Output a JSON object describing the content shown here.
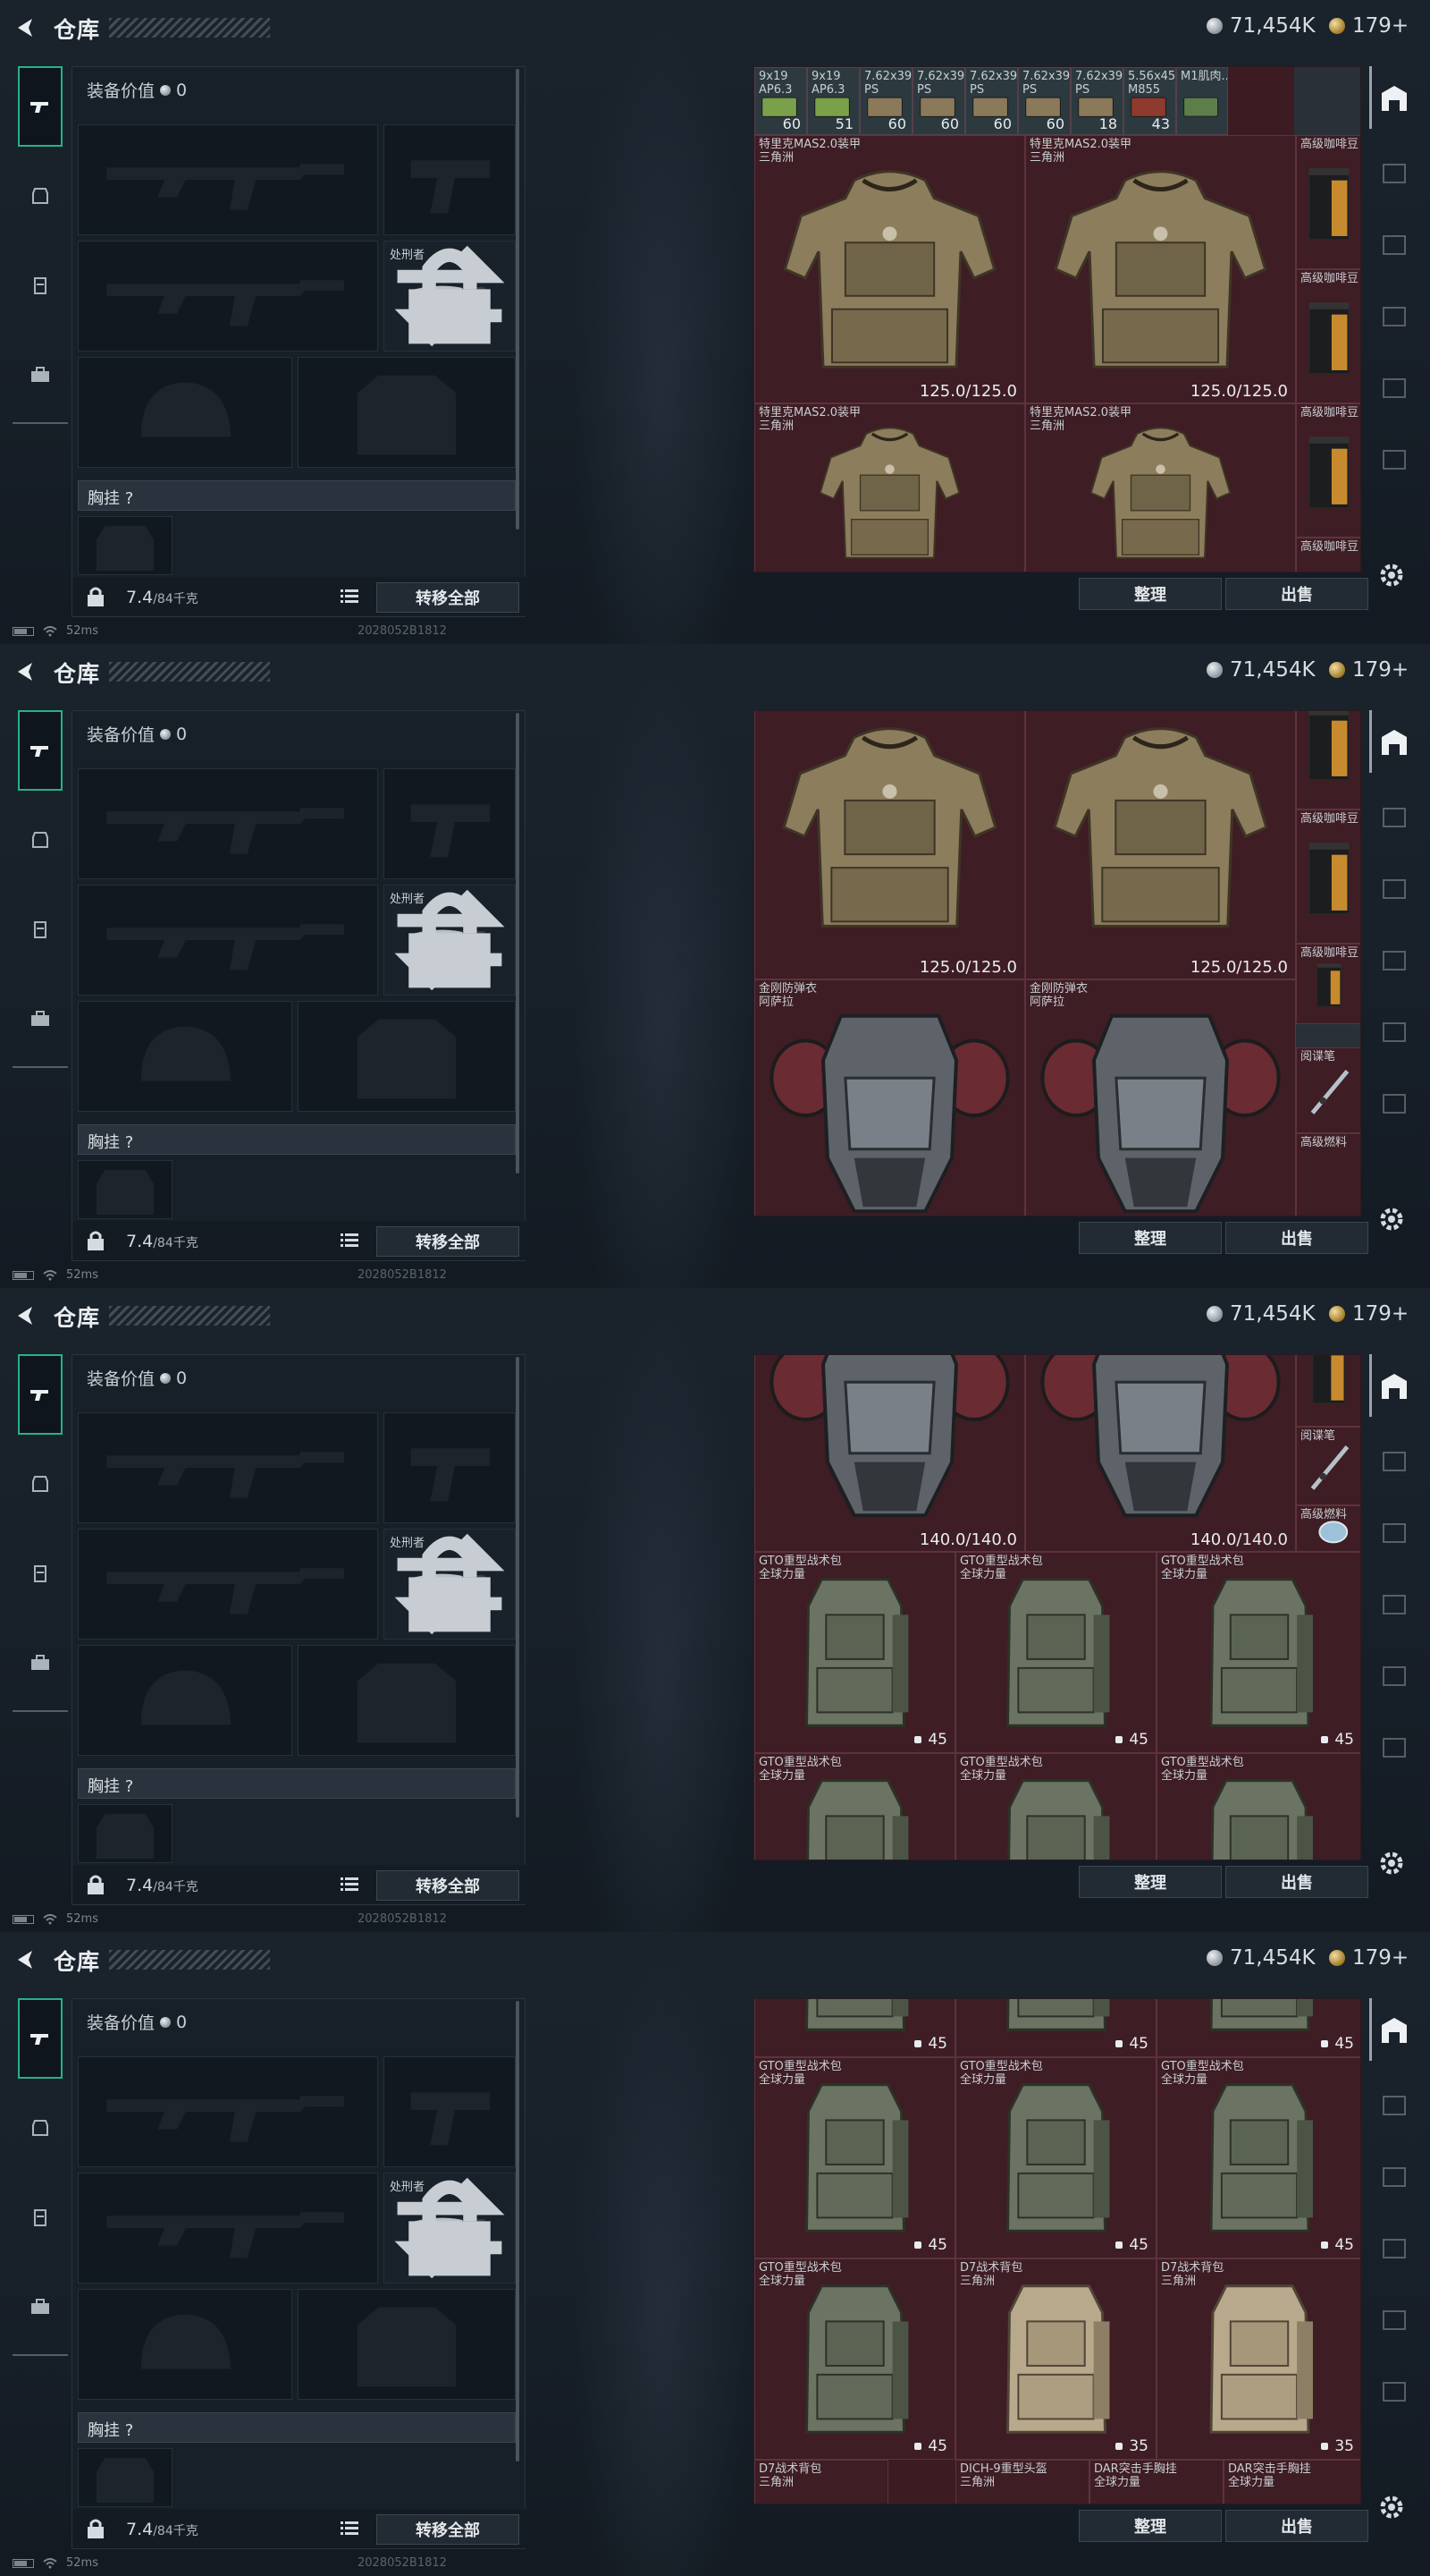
{
  "title": "仓库",
  "currency": {
    "silver": "71,454K",
    "gold": "179+"
  },
  "equipment": {
    "value_label": "装备价值",
    "value": "0",
    "knife_label": "处刑者",
    "chest_label": "胸挂 ?",
    "weight": "7.4",
    "weight_max": "/84千克",
    "transfer_all": "转移全部"
  },
  "storage_buttons": {
    "sort": "整理",
    "sell": "出售"
  },
  "status": {
    "ping": "52ms",
    "build": "2028052B1812"
  },
  "frames": [
    {
      "cells": [
        {
          "name": "9x19\nAP6.3",
          "count": "60",
          "ammo": true
        },
        {
          "name": "9x19\nAP6.3",
          "count": "51",
          "ammo": true
        },
        {
          "name": "7.62x39\nPS",
          "count": "60",
          "ammo": true
        },
        {
          "name": "7.62x39\nPS",
          "count": "60",
          "ammo": true
        },
        {
          "name": "7.62x39\nPS",
          "count": "60",
          "ammo": true
        },
        {
          "name": "7.62x39\nPS",
          "count": "60",
          "ammo": true
        },
        {
          "name": "7.62x39\nPS",
          "count": "18",
          "ammo": true
        },
        {
          "name": "5.56x45\nM855",
          "count": "43",
          "ammo": true
        },
        {
          "name": "M1肌肉...",
          "count": "",
          "ammo": true
        },
        {
          "name": "特里克MAS2.0装甲\n三角洲",
          "dur": "125.0/125.0",
          "art": "vest"
        },
        {
          "name": "特里克MAS2.0装甲\n三角洲",
          "dur": "125.0/125.0",
          "art": "vest"
        },
        {
          "name": "高级咖啡豆",
          "art": "coffee"
        },
        {
          "name": "高级咖啡豆",
          "art": "coffee"
        },
        {
          "name": "特里克MAS2.0装甲\n三角洲",
          "dur": "",
          "art": "vest"
        },
        {
          "name": "特里克MAS2.0装甲\n三角洲",
          "dur": "",
          "art": "vest"
        },
        {
          "name": "高级咖啡豆",
          "art": "coffee"
        },
        {
          "name": "高级咖啡豆",
          "art": "none"
        }
      ]
    },
    {
      "cells": [
        {
          "name": "特里克MAS2.0装甲\n三角洲",
          "dur": "125.0/125.0",
          "art": "vest"
        },
        {
          "name": "特里克MAS2.0装甲\n三角洲",
          "dur": "125.0/125.0",
          "art": "vest"
        },
        {
          "name": "高级咖啡豆",
          "art": "coffee"
        },
        {
          "name": "高级咖啡豆",
          "art": "coffee"
        },
        {
          "name": "金刚防弹衣\n阿萨拉",
          "dur": "",
          "art": "heavy"
        },
        {
          "name": "金刚防弹衣\n阿萨拉",
          "dur": "",
          "art": "heavy"
        },
        {
          "name": "高级咖啡豆",
          "art": "coffee"
        },
        {
          "name": "阅谍笔",
          "art": "pen"
        },
        {
          "name": "高级燃料",
          "art": "none"
        }
      ]
    },
    {
      "cells": [
        {
          "name": "",
          "dur": "140.0/140.0",
          "art": "heavy"
        },
        {
          "name": "",
          "dur": "140.0/140.0",
          "art": "heavy"
        },
        {
          "name": "",
          "art": "coffee"
        },
        {
          "name": "阅谍笔",
          "art": "pen"
        },
        {
          "name": "高级燃料",
          "art": "fuel"
        },
        {
          "name": "GTO重型战术包\n全球力量",
          "cap": "45",
          "art": "pack"
        },
        {
          "name": "GTO重型战术包\n全球力量",
          "cap": "45",
          "art": "pack"
        },
        {
          "name": "GTO重型战术包\n全球力量",
          "cap": "45",
          "art": "pack"
        },
        {
          "name": "GTO重型战术包\n全球力量",
          "cap": "",
          "art": "pack"
        },
        {
          "name": "GTO重型战术包\n全球力量",
          "cap": "",
          "art": "pack"
        },
        {
          "name": "GTO重型战术包\n全球力量",
          "cap": "",
          "art": "pack"
        }
      ]
    },
    {
      "cells": [
        {
          "name": "",
          "cap": "45",
          "art": "pack"
        },
        {
          "name": "",
          "cap": "45",
          "art": "pack"
        },
        {
          "name": "",
          "cap": "45",
          "art": "pack"
        },
        {
          "name": "GTO重型战术包\n全球力量",
          "cap": "45",
          "art": "pack"
        },
        {
          "name": "GTO重型战术包\n全球力量",
          "cap": "45",
          "art": "pack"
        },
        {
          "name": "GTO重型战术包\n全球力量",
          "cap": "45",
          "art": "pack"
        },
        {
          "name": "GTO重型战术包\n全球力量",
          "cap": "45",
          "art": "pack"
        },
        {
          "name": "D7战术背包\n三角洲",
          "cap": "35",
          "art": "tanpack"
        },
        {
          "name": "D7战术背包\n三角洲",
          "cap": "35",
          "art": "tanpack"
        },
        {
          "name": "D7战术背包\n三角洲",
          "art": "none"
        },
        {
          "name": "DICH-9重型头盔\n三角洲",
          "art": "none"
        },
        {
          "name": "DAR突击手胸挂\n全球力量",
          "art": "none"
        },
        {
          "name": "DAR突击手胸挂\n全球力量",
          "art": "none"
        }
      ]
    }
  ]
}
